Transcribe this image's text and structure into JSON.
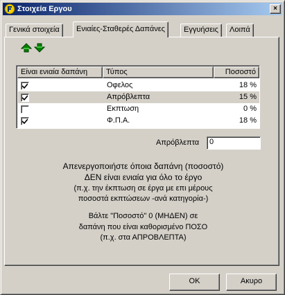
{
  "window": {
    "title": "Στοιχεία Εργου",
    "close_glyph": "×",
    "title_icon": "app-logo-icon"
  },
  "tabs": [
    {
      "label": "Γενικά στοιχεία",
      "active": false
    },
    {
      "label": "Ενιαίες-Σταθερές Δαπάνες",
      "active": true
    },
    {
      "label": "Εγγυήσεις",
      "active": false
    },
    {
      "label": "Λοιπά",
      "active": false
    }
  ],
  "toolbar": {
    "move_up_icon": "arrow-up-icon",
    "move_down_icon": "arrow-down-icon"
  },
  "table": {
    "headers": {
      "uniform": "Είναι ενιαία δαπάνη",
      "type": "Τύπος",
      "percent": "Ποσοστό"
    },
    "rows": [
      {
        "checked": true,
        "type": "Οφελος",
        "percent": "18 %",
        "selected": false
      },
      {
        "checked": true,
        "type": "Απρόβλεπτα",
        "percent": "15 %",
        "selected": true
      },
      {
        "checked": false,
        "type": "Εκπτωση",
        "percent": "0 %",
        "selected": false
      },
      {
        "checked": true,
        "type": "Φ.Π.Α.",
        "percent": "18 %",
        "selected": false
      }
    ]
  },
  "field": {
    "label": "Απρόβλεπτα",
    "value": "0"
  },
  "info": {
    "line1": "Απενεργοποιήστε όποια δαπάνη (ποσοστό)",
    "line2": "ΔΕΝ είναι ενιαία για όλο το έργο",
    "line3": "(π.χ. την έκπτωση σε έργα με επι μέρους",
    "line4": "ποσοστά εκπτώσεων -ανά κατηγορία-)",
    "line5": "Βάλτε \"Ποσοστό\"   0 (ΜΗΔΕΝ)    σε",
    "line6": "δαπάνη που είναι καθορισμένο ΠΟΣΟ",
    "line7": "(π.χ. στα ΑΠΡΟΒΛΕΠΤΑ)"
  },
  "buttons": {
    "ok": "OK",
    "cancel": "Ακυρο"
  },
  "colors": {
    "title_start": "#0a246a",
    "title_end": "#a6caf0",
    "face": "#d4d0c8",
    "arrow_green": "#008000"
  }
}
